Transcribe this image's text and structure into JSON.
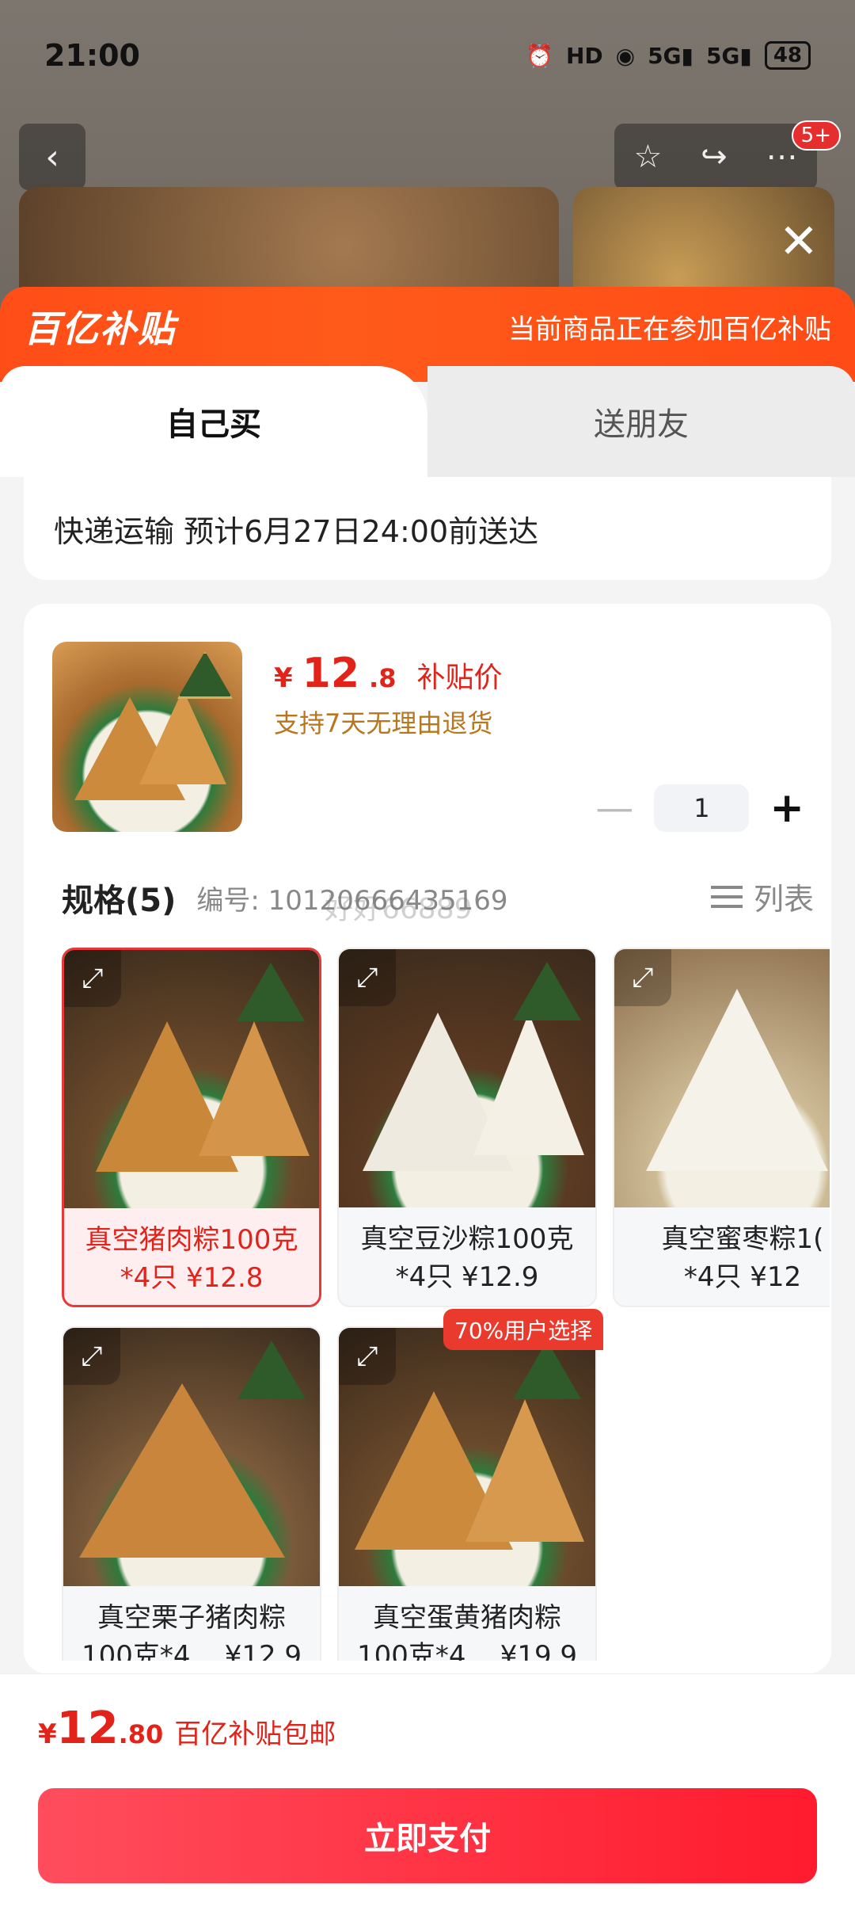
{
  "status_bar": {
    "time": "21:00",
    "icons": [
      "alarm-icon",
      "hd-icon",
      "wifi-icon",
      "5g-signal-icon",
      "5g-signal-icon"
    ],
    "battery": "48"
  },
  "background": {
    "notification_badge": "5+",
    "nav_icons": [
      "back-icon",
      "star-icon",
      "share-icon",
      "more-icon"
    ]
  },
  "banner": {
    "brand": "百亿补贴",
    "note": "当前商品正在参加百亿补贴"
  },
  "tabs": [
    {
      "label": "自己买",
      "active": true
    },
    {
      "label": "送朋友",
      "active": false
    }
  ],
  "delivery": {
    "text": "快递运输 预计6月27日24:00前送达"
  },
  "product": {
    "price_symbol": "¥",
    "price_int": "12",
    "price_dec": ".8",
    "price_tag": "补贴价",
    "return_note": "支持7天无理由退货",
    "quantity": "1"
  },
  "spec": {
    "title": "规格(5)",
    "code": "编号: 10120666435169",
    "list_toggle": "列表",
    "options": [
      {
        "label": "真空猪肉粽100克\n*4只 ¥12.8",
        "selected": true
      },
      {
        "label": "真空豆沙粽100克\n*4只 ¥12.9",
        "selected": false
      },
      {
        "label": "真空蜜枣粽1(\n*4只 ¥12",
        "selected": false
      },
      {
        "label": "真空栗子猪肉粽\n100克*4... ¥12.9",
        "selected": false
      },
      {
        "label": "真空蛋黄猪肉粽\n100克*4... ¥19.9",
        "selected": false
      }
    ],
    "popular_badge": "70%用户选择",
    "watermark": "好好66889"
  },
  "bottom": {
    "total_symbol": "¥",
    "total_int": "12",
    "total_dec": ".80",
    "total_note": "百亿补贴包邮",
    "pay_button": "立即支付"
  },
  "colors": {
    "accent_red": "#e2231a",
    "banner_orange": "#ff4d17",
    "return_gold": "#b8761f"
  }
}
